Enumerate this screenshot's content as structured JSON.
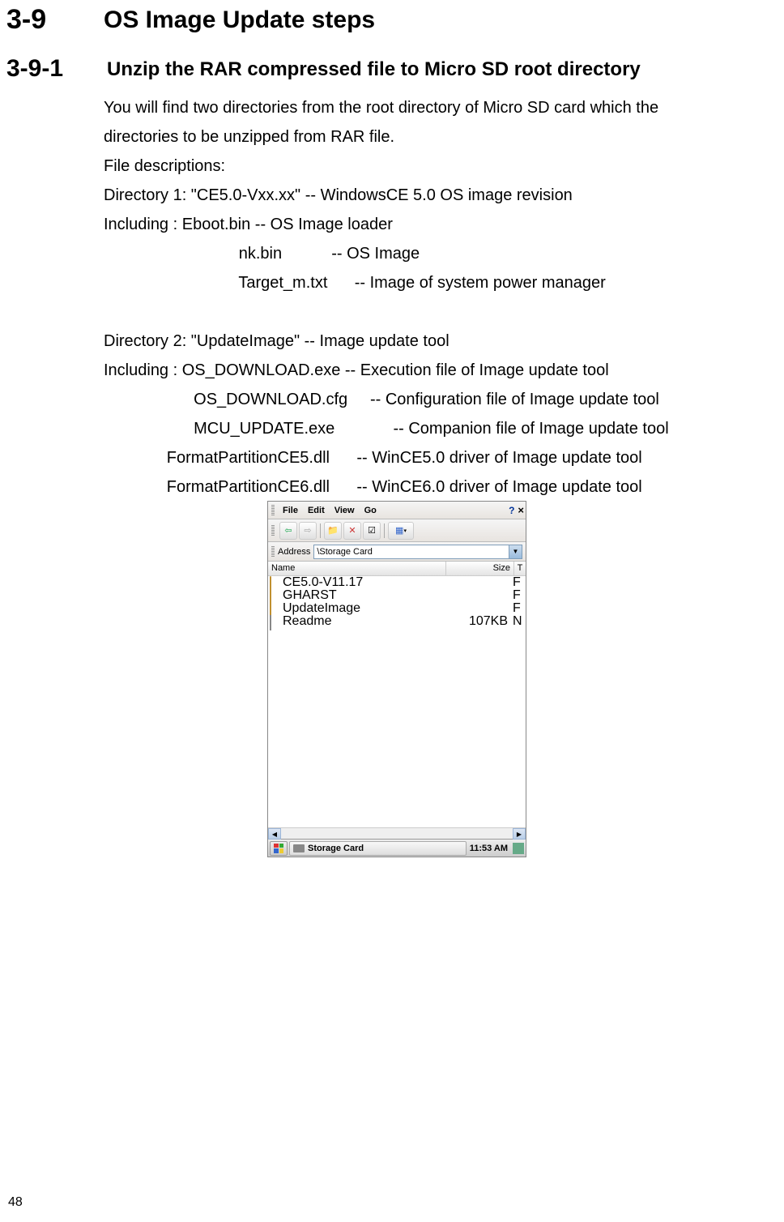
{
  "section1": {
    "num": "3-9",
    "title": "OS Image Update steps"
  },
  "section2": {
    "num": "3-9-1",
    "title": "Unzip the RAR compressed file to Micro SD root directory"
  },
  "body": {
    "p1": "You will find two directories from the root directory of Micro SD card which the",
    "p2": "directories to be unzipped from RAR file.",
    "p3": "File descriptions:",
    "p4": "Directory 1: \"CE5.0-Vxx.xx\"    -- WindowsCE 5.0 OS image revision",
    "p5": "Including   : Eboot.bin           -- OS Image loader",
    "p6": "                              nk.bin           -- OS Image",
    "p7": "                              Target_m.txt      -- Image of system power manager",
    "p8": " ",
    "p9": "Directory 2: \"UpdateImage\"               -- Image update tool",
    "p10": "Including   : OS_DOWNLOAD.exe     -- Execution file of Image update tool",
    "p11": "                    OS_DOWNLOAD.cfg     -- Configuration file of Image update tool",
    "p12": "                    MCU_UPDATE.exe             -- Companion file of Image update tool",
    "p13": "              FormatPartitionCE5.dll      -- WinCE5.0 driver of Image update tool",
    "p14": "              FormatPartitionCE6.dll      -- WinCE6.0 driver of Image update tool"
  },
  "explorer": {
    "menu": {
      "file": "File",
      "edit": "Edit",
      "view": "View",
      "go": "Go"
    },
    "addr_label": "Address",
    "addr_value": "\\Storage Card",
    "cols": {
      "name": "Name",
      "size": "Size",
      "type": "T"
    },
    "rows": [
      {
        "name": "CE5.0-V11.17",
        "size": "",
        "type": "F",
        "kind": "folder"
      },
      {
        "name": "GHARST",
        "size": "",
        "type": "F",
        "kind": "folder"
      },
      {
        "name": "UpdateImage",
        "size": "",
        "type": "F",
        "kind": "folder"
      },
      {
        "name": "Readme",
        "size": "107KB",
        "type": "N",
        "kind": "file"
      }
    ],
    "task_label": "Storage Card",
    "clock": "11:53 AM"
  },
  "pagenum": "48"
}
